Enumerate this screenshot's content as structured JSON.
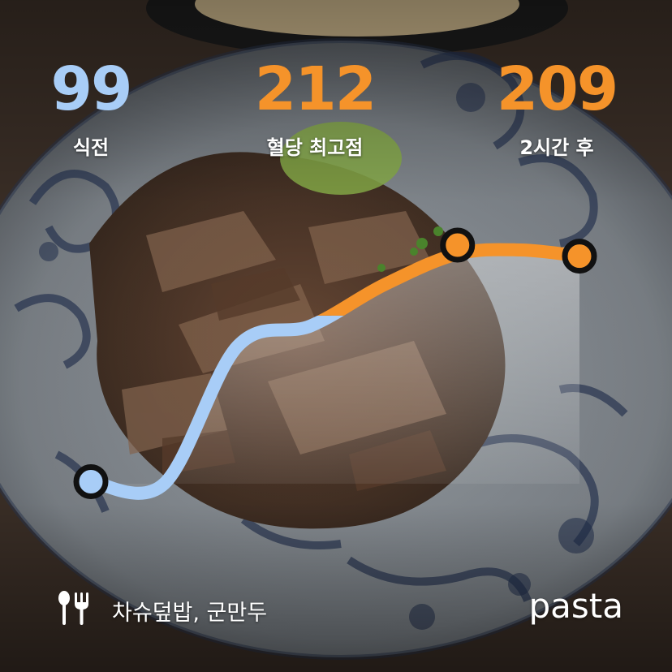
{
  "colors": {
    "before": "#a8cdf7",
    "peak": "#f5932a",
    "after": "#f5932a",
    "label": "#ffffff",
    "marker_stroke": "#111111"
  },
  "stats": {
    "before": {
      "value": "99",
      "label": "식전"
    },
    "peak": {
      "value": "212",
      "label": "혈당 최고점"
    },
    "after": {
      "value": "209",
      "label": "2시간 후"
    }
  },
  "glucose_curve": {
    "points": [
      {
        "t": 0,
        "value": 99
      },
      {
        "t": 0.15,
        "value": 98
      },
      {
        "t": 0.3,
        "value": 165
      },
      {
        "t": 0.45,
        "value": 175
      },
      {
        "t": 0.6,
        "value": 195
      },
      {
        "t": 0.75,
        "value": 210
      },
      {
        "t": 0.88,
        "value": 212
      },
      {
        "t": 1,
        "value": 209
      }
    ],
    "threshold_value": 180
  },
  "footer": {
    "food_icon": "fork-knife-icon",
    "food_text": "차슈덮밥, 군만두",
    "brand": "pasta"
  }
}
